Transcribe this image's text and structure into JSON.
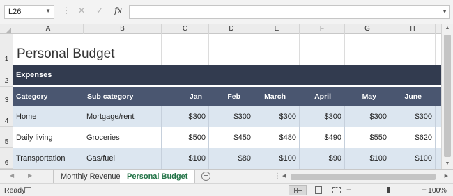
{
  "formula_bar": {
    "name_box": "L26",
    "formula": "",
    "icons": [
      "cancel-icon",
      "enter-icon",
      "function-icon"
    ]
  },
  "columns": [
    "A",
    "B",
    "C",
    "D",
    "E",
    "F",
    "G",
    "H"
  ],
  "rows": [
    "1",
    "2",
    "3",
    "4",
    "5",
    "6"
  ],
  "sheet": {
    "title": "Personal Budget",
    "section": "Expenses",
    "headers": [
      "Category",
      "Sub category",
      "Jan",
      "Feb",
      "March",
      "April",
      "May",
      "June"
    ],
    "data": [
      [
        "Home",
        "Mortgage/rent",
        "$300",
        "$300",
        "$300",
        "$300",
        "$300",
        "$300"
      ],
      [
        "Daily living",
        "Groceries",
        "$500",
        "$450",
        "$480",
        "$490",
        "$550",
        "$620"
      ],
      [
        "Transportation",
        "Gas/fuel",
        "$100",
        "$80",
        "$100",
        "$90",
        "$100",
        "$100"
      ]
    ]
  },
  "tabs": [
    {
      "label": "Monthly Revenue",
      "active": false
    },
    {
      "label": "Personal Budget",
      "active": true
    }
  ],
  "status": {
    "text": "Ready",
    "zoom": "100%"
  },
  "colors": {
    "section_band": "#323b4f",
    "header_band": "#4a5670",
    "row_shade": "#dce6f0",
    "active_tab": "#217346"
  }
}
